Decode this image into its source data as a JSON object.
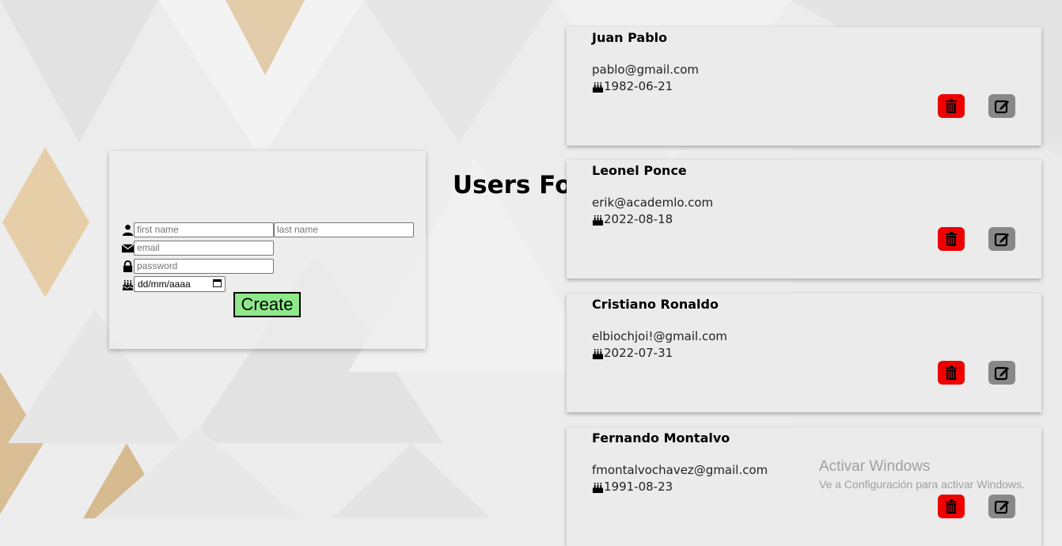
{
  "form": {
    "title": "Users Form",
    "first_name_placeholder": "first name",
    "last_name_placeholder": "last name",
    "email_placeholder": "email",
    "password_placeholder": "password",
    "date_placeholder": "dd/mm/aaaa",
    "create_label": "Create"
  },
  "users": [
    {
      "name": "Juan Pablo",
      "email": "pablo@gmail.com",
      "birthday": "1982-06-21"
    },
    {
      "name": "Leonel Ponce",
      "email": "erik@academlo.com",
      "birthday": "2022-08-18"
    },
    {
      "name": "Cristiano Ronaldo",
      "email": "elbiochjoi!@gmail.com",
      "birthday": "2022-07-31"
    },
    {
      "name": "Fernando Montalvo",
      "email": "fmontalvochavez@gmail.com",
      "birthday": "1991-08-23"
    }
  ],
  "icons": {
    "user": "user-icon",
    "email": "envelope-icon",
    "password": "lock-icon",
    "birthday": "birthday-cake-icon",
    "delete": "trash-icon",
    "edit": "edit-icon",
    "calendar": "calendar-icon"
  },
  "colors": {
    "create_button": "#8ee88a",
    "delete_button": "#ee0000",
    "edit_button": "#888888"
  },
  "windows_watermark": {
    "title": "Activar Windows",
    "subtitle": "Ve a Configuración para activar Windows."
  }
}
